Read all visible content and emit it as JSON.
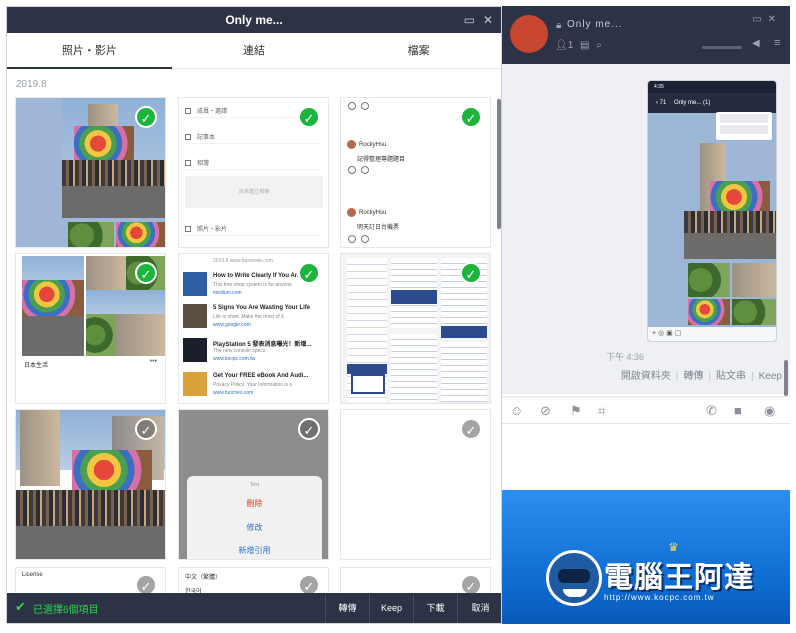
{
  "left_window": {
    "title": "Only me...",
    "window_buttons": [
      "▭",
      "✕"
    ],
    "tabs": [
      "照片‧影片",
      "連結",
      "檔案"
    ],
    "active_tab": 0,
    "date_label": "2019.8",
    "grid": {
      "cells": [
        {
          "kind": "photo",
          "checked": true
        },
        {
          "kind": "notes-doc",
          "checked": true,
          "rows": [
            "成員‧邀請",
            "記事本",
            "相簿",
            "照片‧影片"
          ],
          "placeholder": "尚未建立相簿"
        },
        {
          "kind": "chat-log",
          "checked": true,
          "user": "RockyHsu",
          "messages": [
            "記得整理專題題目",
            "明天訂日台機票"
          ]
        },
        {
          "kind": "photo-collage",
          "checked": true,
          "caption": "日本生活"
        },
        {
          "kind": "link-list",
          "checked": true,
          "links": [
            {
              "title": "",
              "desc": "",
              "url": "2019.8 www.facebook.com"
            },
            {
              "title": "How to Write Clearly If You Ar...",
              "desc": "This free shop system is for anyone",
              "url": "medium.com"
            },
            {
              "title": "5 Signs You Are Wasting Your Life",
              "desc": "Life is short. Make the most of it.",
              "url": "www.google.com"
            },
            {
              "title": "PlayStation 5 發表消息曝光！新增...",
              "desc": "The new console specs",
              "url": "www.kocpc.com.tw"
            },
            {
              "title": "Get Your FREE eBook And Audi...",
              "desc": "Privacy Policy: Your information is s",
              "url": "www.funcnes.com"
            }
          ]
        },
        {
          "kind": "screenshot-docs",
          "checked": true
        },
        {
          "kind": "photo",
          "checked": false
        },
        {
          "kind": "popup-menu",
          "checked": false,
          "menu_title": "Text",
          "menu_items": [
            "刪除",
            "修改",
            "新增引用"
          ]
        },
        {
          "kind": "blank",
          "checked": false
        },
        {
          "kind": "license",
          "checked": false,
          "label": "License"
        },
        {
          "kind": "languages",
          "checked": false,
          "items": [
            "中文（繁體）",
            "한국어"
          ]
        },
        {
          "kind": "blank",
          "checked": false
        }
      ]
    },
    "bottom_bar": {
      "selected_text": "已選擇6個項目",
      "buttons": [
        "轉傳",
        "Keep",
        "下載",
        "取消"
      ]
    }
  },
  "right_window": {
    "title": "Only me...",
    "member_count": "1",
    "window_buttons": [
      "▭",
      "✕"
    ],
    "phone": {
      "status_time": "4:35",
      "nav_title": "Only me... (1)",
      "back_count": "71"
    },
    "chat_time": "下午 4:36",
    "chat_actions": [
      "開啟資料夾",
      "轉傳",
      "貼文串",
      "Keep"
    ],
    "toolbar_icons": [
      "emoji-icon",
      "attach-icon",
      "keep-icon",
      "crop-icon",
      "phone-icon",
      "video-icon",
      "mic-icon"
    ]
  },
  "watermark": {
    "name": "電腦王阿達",
    "url": "http://www.kocpc.com.tw"
  },
  "colors": {
    "title_bar": "#2c3346",
    "check_on": "#1cb53b",
    "selected_text": "#2ed24a",
    "desktop_blue": "#0e6bd0"
  }
}
